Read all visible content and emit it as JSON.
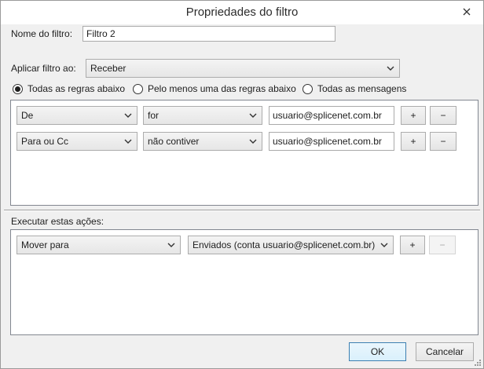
{
  "window": {
    "title": "Propriedades do filtro"
  },
  "filter_name": {
    "label": "Nome do filtro:",
    "value": "Filtro 2"
  },
  "apply_to": {
    "label": "Aplicar filtro ao:",
    "value": "Receber"
  },
  "match_mode": {
    "options": [
      {
        "label": "Todas as regras abaixo",
        "selected": true
      },
      {
        "label": "Pelo menos uma das regras abaixo",
        "selected": false
      },
      {
        "label": "Todas as mensagens",
        "selected": false
      }
    ]
  },
  "rules": [
    {
      "field": "De",
      "operator": "for",
      "value": "usuario@splicenet.com.br",
      "add": "+",
      "remove": "−"
    },
    {
      "field": "Para ou Cc",
      "operator": "não contiver",
      "value": "usuario@splicenet.com.br",
      "add": "+",
      "remove": "−"
    }
  ],
  "actions": {
    "label": "Executar estas ações:",
    "items": [
      {
        "action": "Mover para",
        "target": "Enviados (conta usuario@splicenet.com.br)",
        "add": "+",
        "remove": "−"
      }
    ]
  },
  "buttons": {
    "ok": "OK",
    "cancel": "Cancelar"
  },
  "colors": {
    "ok_border": "#3c7fb1",
    "panel_border": "#828790"
  }
}
